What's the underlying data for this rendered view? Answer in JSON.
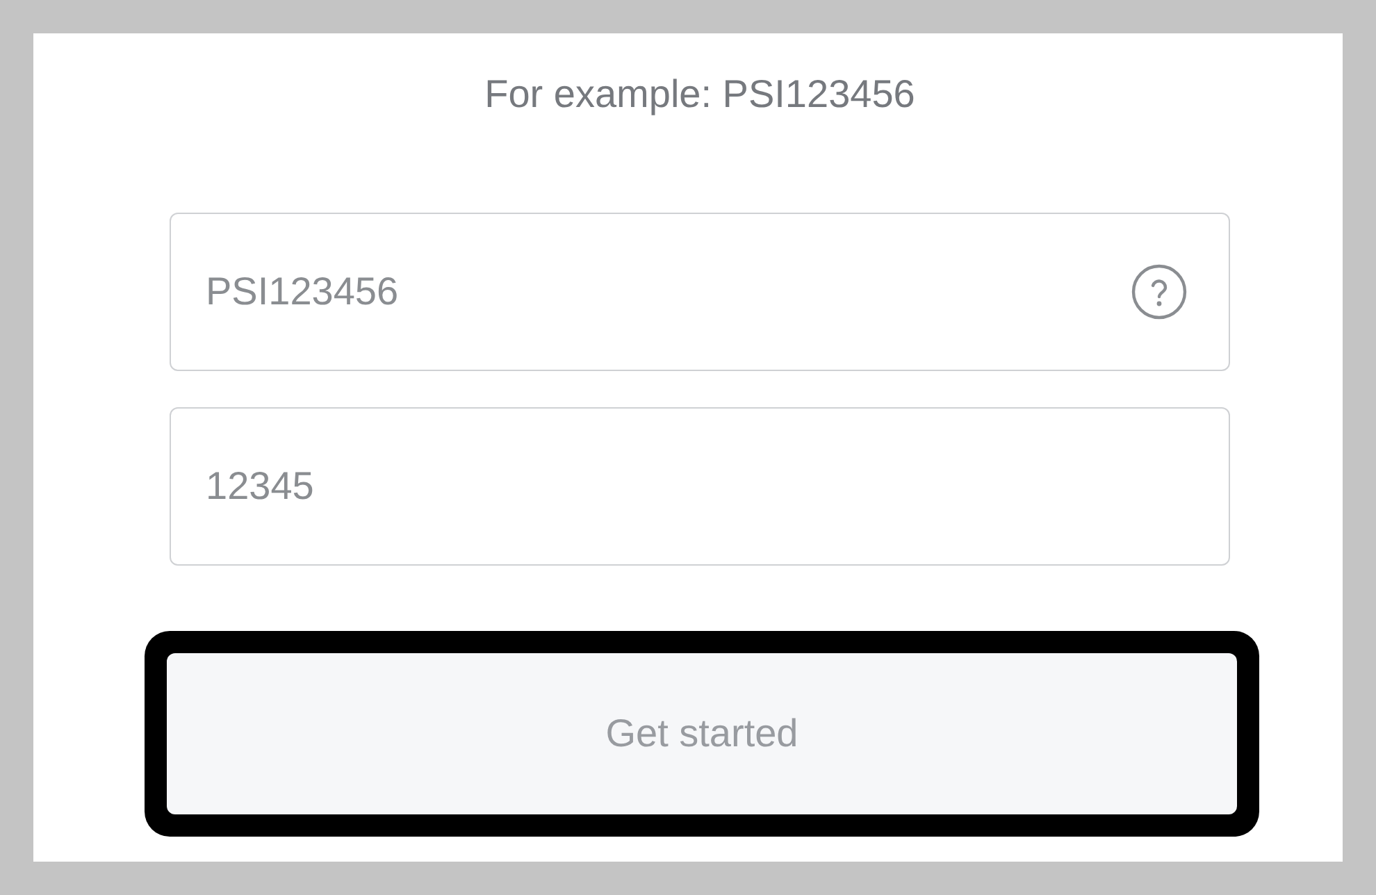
{
  "hint": "For example: PSI123456",
  "fields": [
    {
      "kind": "with_help",
      "placeholder": "PSI123456"
    },
    {
      "kind": "plain",
      "placeholder": "12345"
    }
  ],
  "button": {
    "label": "Get started",
    "disabled": true,
    "focused": true
  }
}
